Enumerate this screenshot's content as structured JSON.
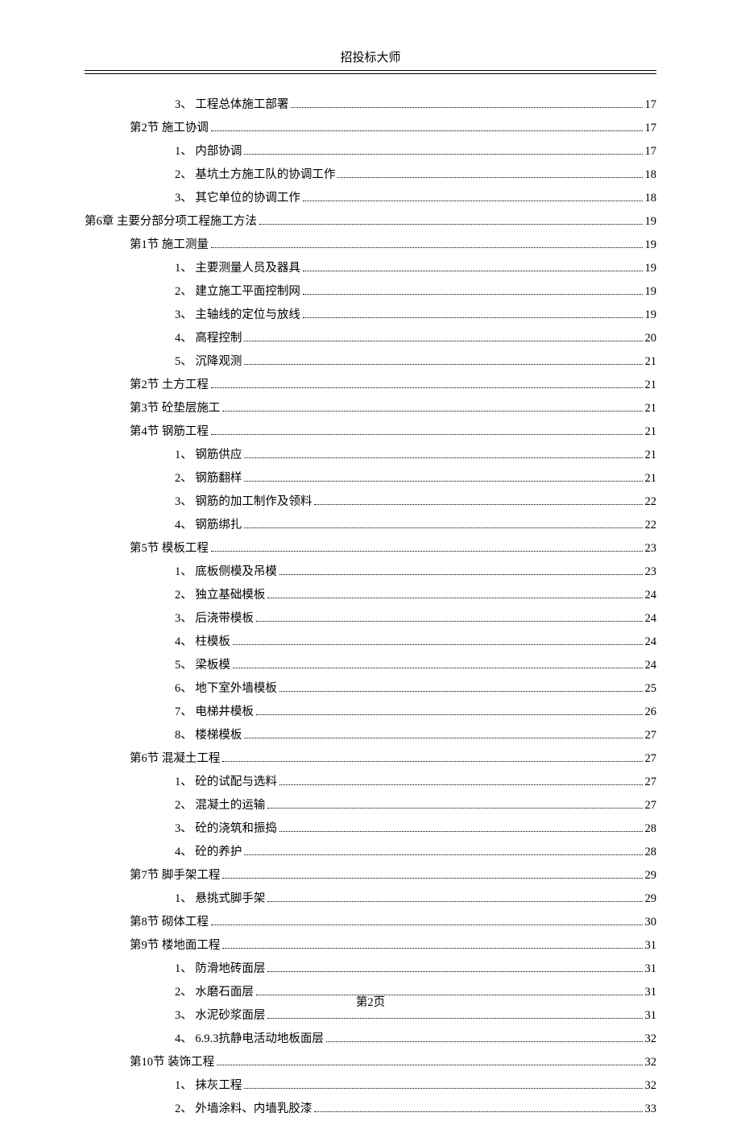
{
  "header": {
    "title": "招投标大师"
  },
  "footer": {
    "page_label": "第2页"
  },
  "toc": [
    {
      "level": 3,
      "label": "3、 工程总体施工部署",
      "page": "17"
    },
    {
      "level": 2,
      "label": "第2节 施工协调",
      "page": "17"
    },
    {
      "level": 3,
      "label": "1、 内部协调",
      "page": "17"
    },
    {
      "level": 3,
      "label": "2、 基坑土方施工队的协调工作",
      "page": "18"
    },
    {
      "level": 3,
      "label": "3、 其它单位的协调工作",
      "page": "18"
    },
    {
      "level": 1,
      "label": "第6章 主要分部分项工程施工方法",
      "page": "19"
    },
    {
      "level": 2,
      "label": "第1节 施工测量",
      "page": "19"
    },
    {
      "level": 3,
      "label": "1、 主要测量人员及器具",
      "page": "19"
    },
    {
      "level": 3,
      "label": "2、 建立施工平面控制网",
      "page": "19"
    },
    {
      "level": 3,
      "label": "3、 主轴线的定位与放线",
      "page": "19"
    },
    {
      "level": 3,
      "label": "4、 高程控制",
      "page": "20"
    },
    {
      "level": 3,
      "label": "5、 沉降观测",
      "page": "21"
    },
    {
      "level": 2,
      "label": "第2节 土方工程",
      "page": "21"
    },
    {
      "level": 2,
      "label": "第3节 砼垫层施工",
      "page": "21"
    },
    {
      "level": 2,
      "label": "第4节 钢筋工程",
      "page": "21"
    },
    {
      "level": 3,
      "label": "1、 钢筋供应",
      "page": "21"
    },
    {
      "level": 3,
      "label": "2、 钢筋翻样",
      "page": "21"
    },
    {
      "level": 3,
      "label": "3、 钢筋的加工制作及领料",
      "page": "22"
    },
    {
      "level": 3,
      "label": "4、 钢筋绑扎",
      "page": "22"
    },
    {
      "level": 2,
      "label": "第5节 模板工程",
      "page": "23"
    },
    {
      "level": 3,
      "label": "1、 底板侧模及吊模",
      "page": "23"
    },
    {
      "level": 3,
      "label": "2、 独立基础模板",
      "page": "24"
    },
    {
      "level": 3,
      "label": "3、 后浇带模板",
      "page": "24"
    },
    {
      "level": 3,
      "label": "4、 柱模板",
      "page": "24"
    },
    {
      "level": 3,
      "label": "5、 梁板模",
      "page": "24"
    },
    {
      "level": 3,
      "label": "6、 地下室外墙模板",
      "page": "25"
    },
    {
      "level": 3,
      "label": "7、 电梯井模板",
      "page": "26"
    },
    {
      "level": 3,
      "label": "8、 楼梯模板",
      "page": "27"
    },
    {
      "level": 2,
      "label": "第6节 混凝土工程",
      "page": "27"
    },
    {
      "level": 3,
      "label": "1、 砼的试配与选料",
      "page": "27"
    },
    {
      "level": 3,
      "label": "2、 混凝土的运输",
      "page": "27"
    },
    {
      "level": 3,
      "label": "3、 砼的浇筑和振捣",
      "page": "28"
    },
    {
      "level": 3,
      "label": "4、 砼的养护",
      "page": "28"
    },
    {
      "level": 2,
      "label": "第7节 脚手架工程",
      "page": "29"
    },
    {
      "level": 3,
      "label": "1、 悬挑式脚手架",
      "page": "29"
    },
    {
      "level": 2,
      "label": "第8节 砌体工程",
      "page": "30"
    },
    {
      "level": 2,
      "label": "第9节 楼地面工程",
      "page": "31"
    },
    {
      "level": 3,
      "label": "1、 防滑地砖面层",
      "page": "31"
    },
    {
      "level": 3,
      "label": "2、 水磨石面层",
      "page": "31"
    },
    {
      "level": 3,
      "label": "3、 水泥砂浆面层",
      "page": "31"
    },
    {
      "level": 3,
      "label": "4、 6.9.3抗静电活动地板面层",
      "page": "32"
    },
    {
      "level": 2,
      "label": "第10节 装饰工程",
      "page": "32"
    },
    {
      "level": 3,
      "label": "1、 抹灰工程",
      "page": "32"
    },
    {
      "level": 3,
      "label": "2、 外墙涂料、内墙乳胶漆",
      "page": "33"
    }
  ]
}
